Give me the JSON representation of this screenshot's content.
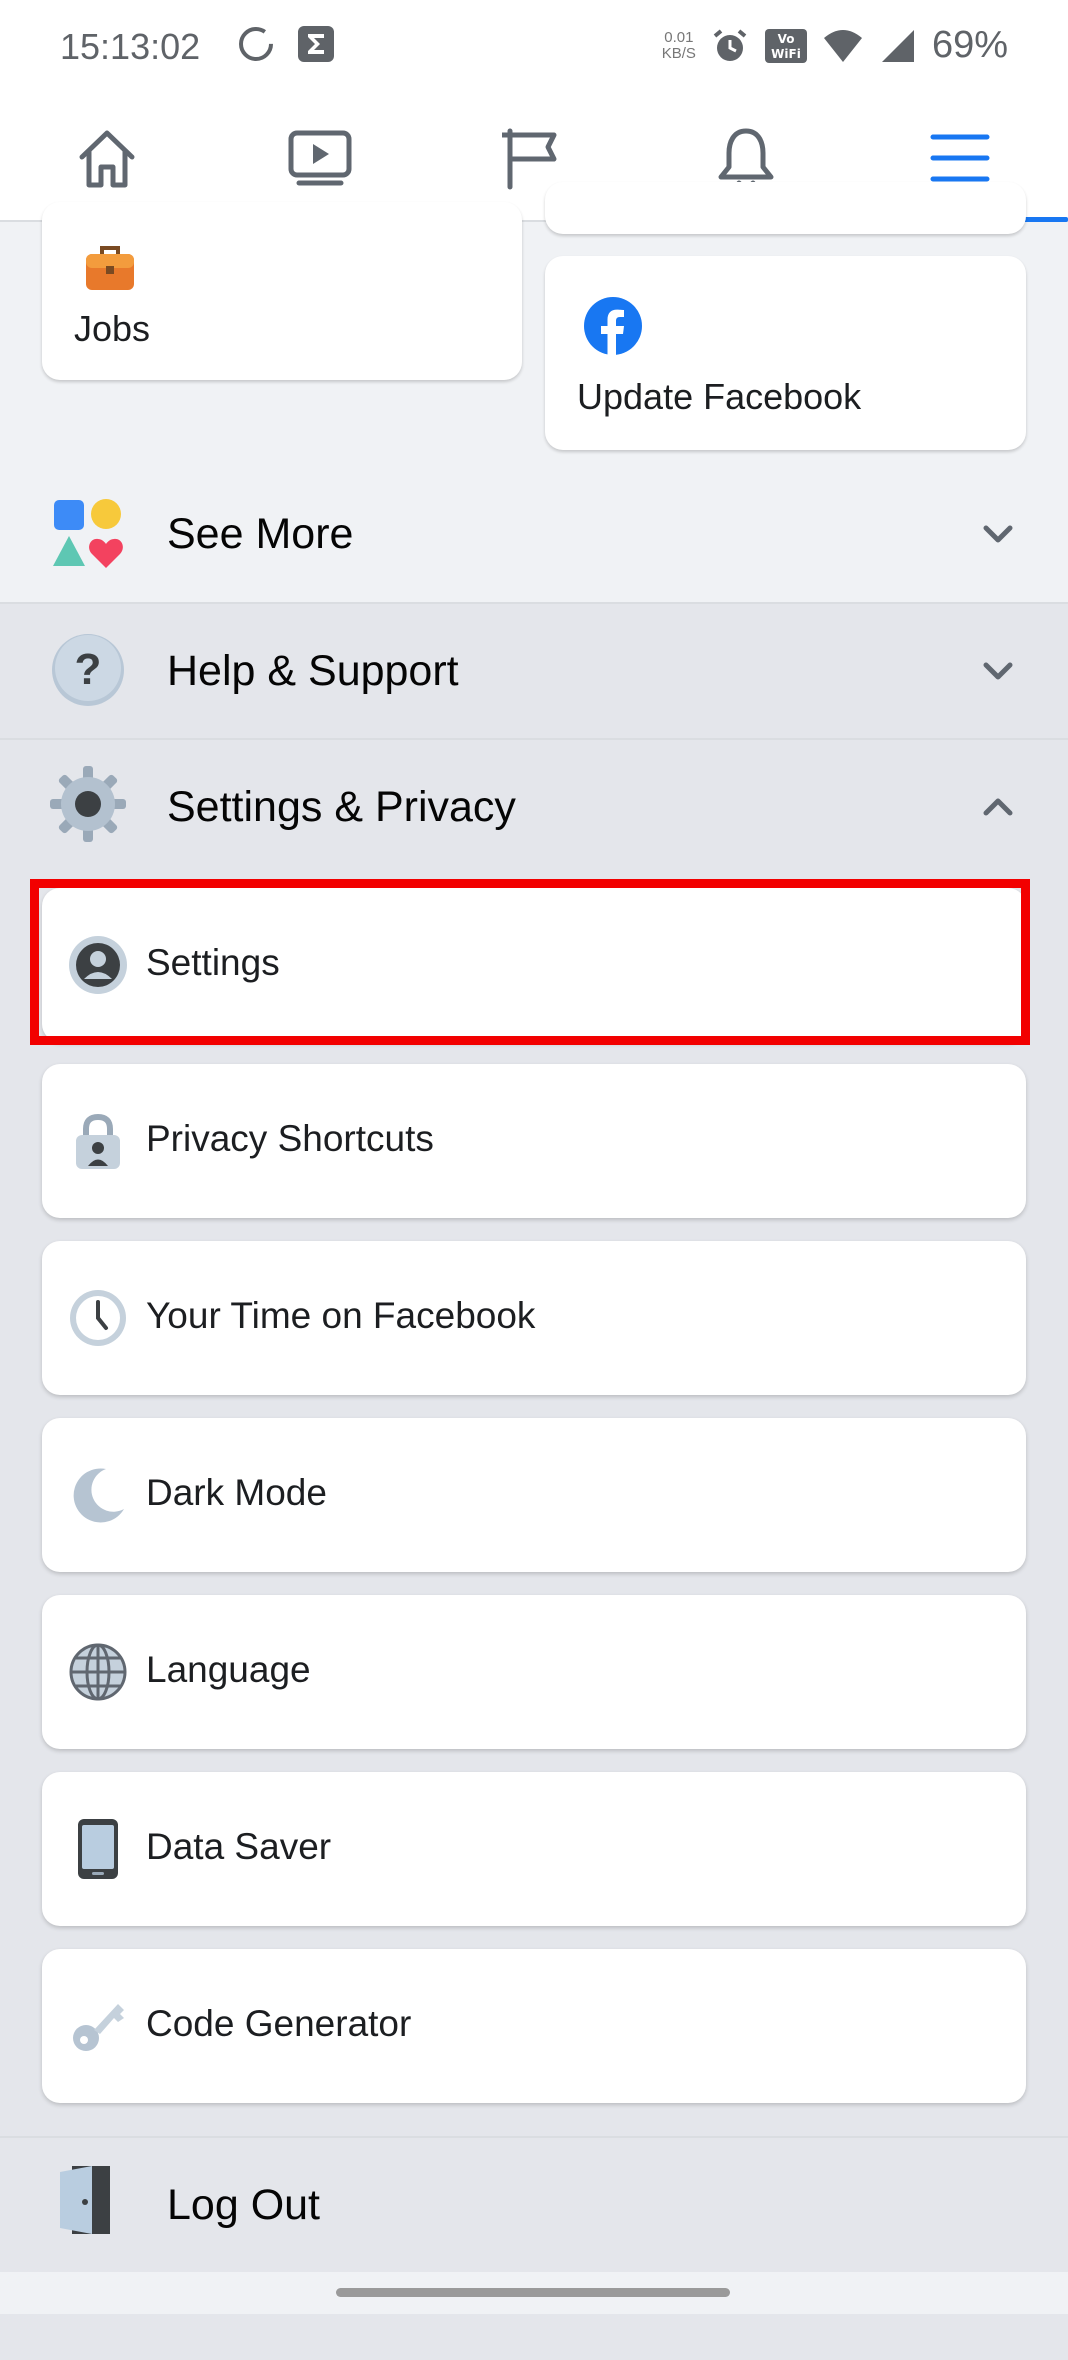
{
  "status_bar": {
    "time": "15:13:02",
    "speed_value": "0.01",
    "speed_unit": "KB/S",
    "battery": "69%"
  },
  "nav": {
    "items": [
      {
        "icon": "home-icon"
      },
      {
        "icon": "video-icon"
      },
      {
        "icon": "flag-icon"
      },
      {
        "icon": "bell-icon"
      },
      {
        "icon": "menu-icon",
        "active": true
      }
    ],
    "accent": "#1877f2"
  },
  "shortcuts": {
    "jobs_label": "Jobs",
    "update_label": "Update Facebook"
  },
  "sections": {
    "see_more": "See More",
    "help_support": "Help & Support",
    "settings_privacy": "Settings & Privacy",
    "log_out": "Log Out"
  },
  "settings_items": [
    {
      "label": "Settings",
      "icon": "account-icon"
    },
    {
      "label": "Privacy Shortcuts",
      "icon": "lock-icon"
    },
    {
      "label": "Your Time on Facebook",
      "icon": "clock-icon"
    },
    {
      "label": "Dark Mode",
      "icon": "moon-icon"
    },
    {
      "label": "Language",
      "icon": "globe-icon"
    },
    {
      "label": "Data Saver",
      "icon": "phone-icon"
    },
    {
      "label": "Code Generator",
      "icon": "key-icon"
    }
  ],
  "colors": {
    "highlight": "#f20000",
    "facebook_blue": "#1877f2"
  }
}
